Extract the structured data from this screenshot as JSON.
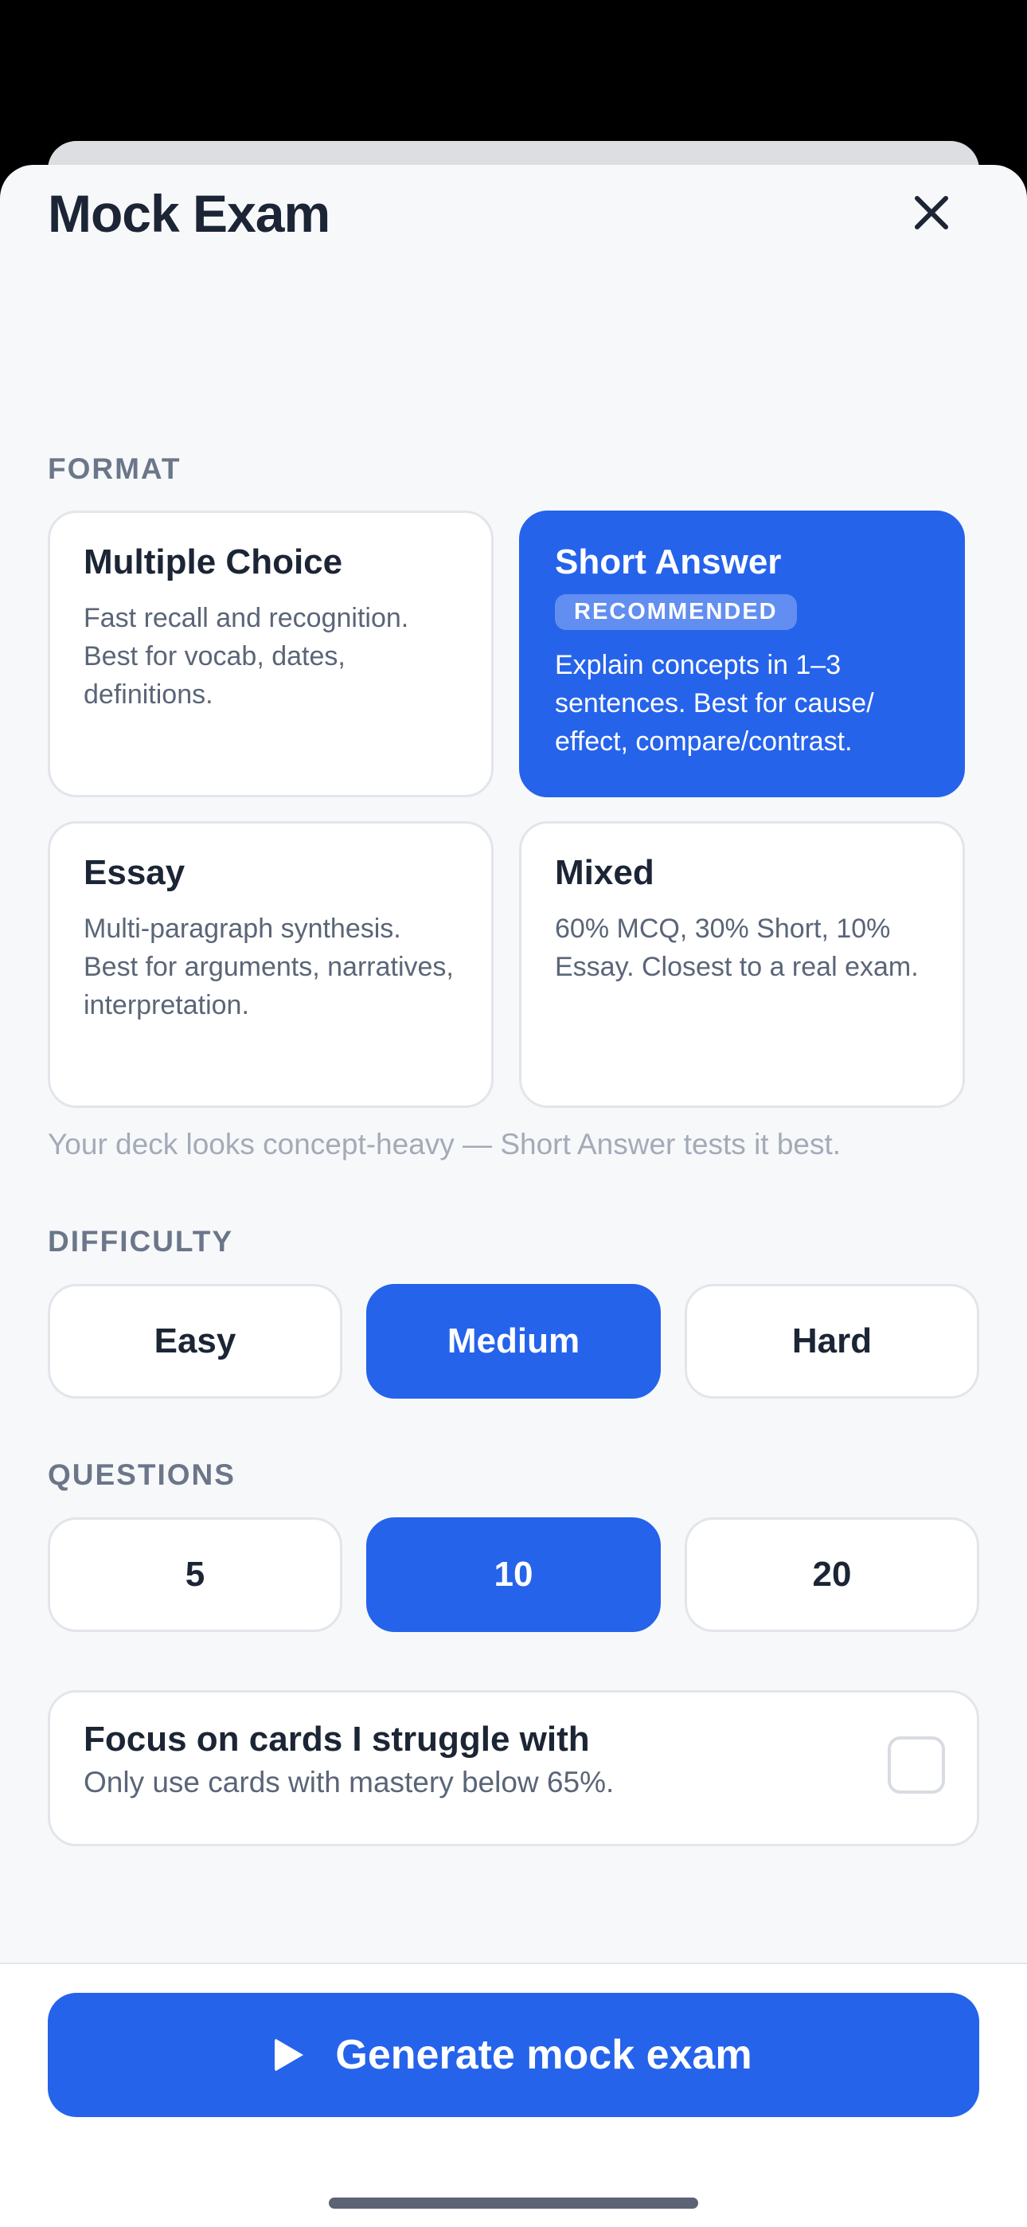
{
  "sheet": {
    "title": "Mock Exam",
    "close_icon": "close-icon"
  },
  "format": {
    "label": "FORMAT",
    "options": [
      {
        "title": "Multiple Choice",
        "description": "Fast recall and recognition. Best for vocab, dates, definitions.",
        "selected": false
      },
      {
        "title": "Short Answer",
        "badge": "RECOMMENDED",
        "description": "Explain concepts in 1–3 sentences. Best for cause/ effect, compare/contrast.",
        "selected": true
      },
      {
        "title": "Essay",
        "description": "Multi-paragraph synthesis. Best for arguments, narratives, interpretation.",
        "selected": false
      },
      {
        "title": "Mixed",
        "description": "60% MCQ, 30% Short, 10% Essay. Closest to a real exam.",
        "selected": false
      }
    ],
    "hint": "Your deck looks concept-heavy — Short Answer tests it best."
  },
  "difficulty": {
    "label": "DIFFICULTY",
    "options": [
      "Easy",
      "Medium",
      "Hard"
    ],
    "selected": "Medium"
  },
  "questions": {
    "label": "QUESTIONS",
    "options": [
      "5",
      "10",
      "20"
    ],
    "selected": "10"
  },
  "focus": {
    "title": "Focus on cards I struggle with",
    "subtitle": "Only use cards with mastery below 65%.",
    "checked": false
  },
  "footer": {
    "generate_label": "Generate mock exam",
    "generate_icon": "play-icon"
  },
  "colors": {
    "accent": "#2563eb",
    "text": "#1c2535",
    "muted": "#5a6577",
    "background": "#f7f8fa"
  }
}
